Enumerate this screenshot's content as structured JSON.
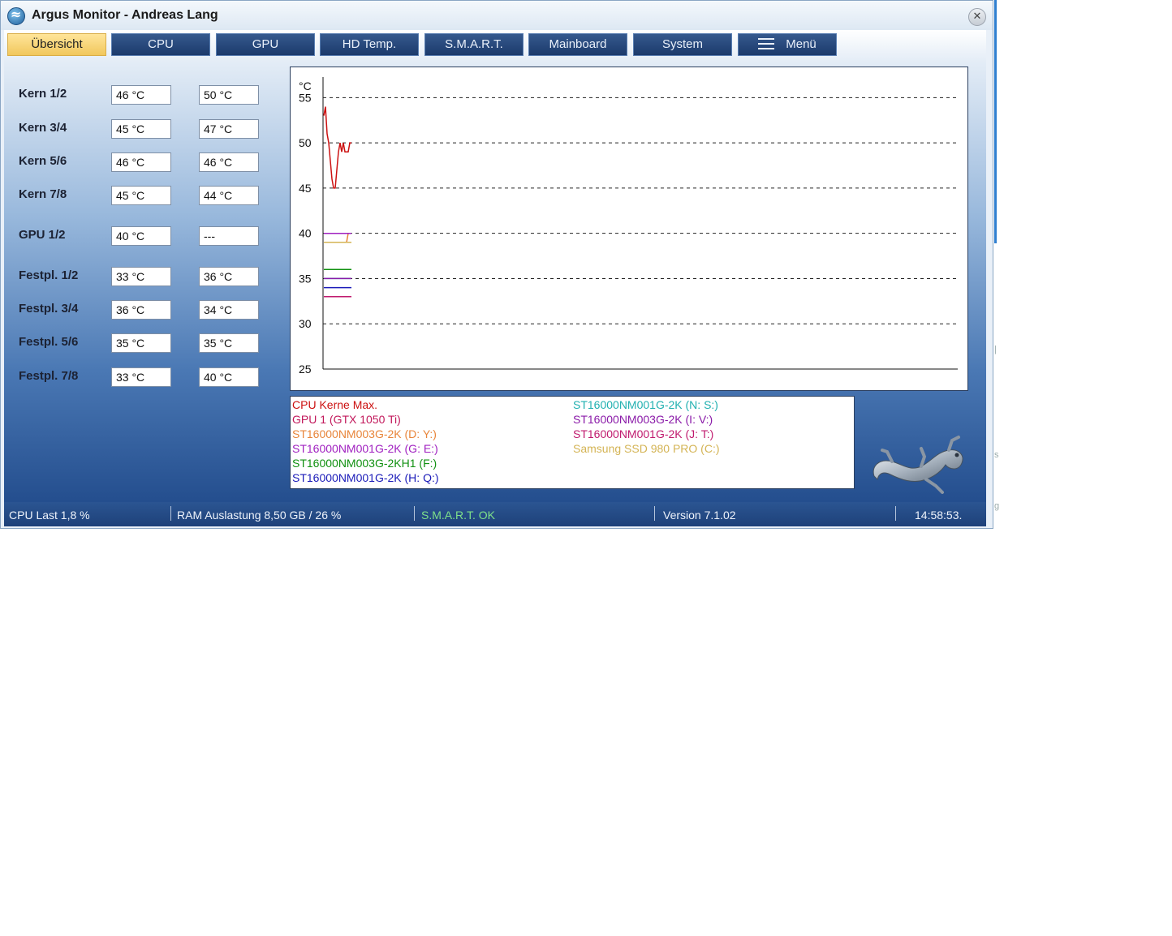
{
  "window": {
    "title": "Argus Monitor - Andreas Lang"
  },
  "tabs": [
    {
      "label": "Übersicht",
      "active": true
    },
    {
      "label": "CPU"
    },
    {
      "label": "GPU"
    },
    {
      "label": "HD Temp."
    },
    {
      "label": "S.M.A.R.T."
    },
    {
      "label": "Mainboard"
    },
    {
      "label": "System"
    },
    {
      "label": "Menü",
      "icon": "hamburger-menu-icon"
    }
  ],
  "sensors": [
    {
      "label": "Kern 1/2",
      "v1": "46 °C",
      "v2": "50 °C"
    },
    {
      "label": "Kern 3/4",
      "v1": "45 °C",
      "v2": "47 °C"
    },
    {
      "label": "Kern 5/6",
      "v1": "46 °C",
      "v2": "46 °C"
    },
    {
      "label": "Kern 7/8",
      "v1": "45 °C",
      "v2": "44 °C"
    },
    {
      "label": "GPU 1/2",
      "v1": "40 °C",
      "v2": "---"
    },
    {
      "label": "Festpl. 1/2",
      "v1": "33 °C",
      "v2": "36 °C"
    },
    {
      "label": "Festpl. 3/4",
      "v1": "36 °C",
      "v2": "34 °C"
    },
    {
      "label": "Festpl. 5/6",
      "v1": "35 °C",
      "v2": "35 °C"
    },
    {
      "label": "Festpl. 7/8",
      "v1": "33 °C",
      "v2": "40 °C"
    }
  ],
  "chart_data": {
    "type": "line",
    "unit_label": "°C",
    "ylim": [
      25,
      57
    ],
    "yticks": [
      25,
      30,
      35,
      40,
      45,
      50,
      55
    ],
    "grid": "dashed horizontal",
    "series": [
      {
        "name": "CPU Kerne Max.",
        "color": "#cc1111",
        "values": [
          53,
          54,
          51,
          50,
          48,
          46,
          45,
          45,
          47,
          49,
          50,
          49,
          50,
          49,
          49,
          49,
          50,
          50
        ]
      },
      {
        "name": "GPU 1 (GTX 1050 Ti)",
        "color": "#c2185b",
        "values": [
          40,
          40,
          40,
          40,
          40,
          40,
          40,
          40,
          40,
          40,
          40,
          40,
          40,
          40,
          40,
          40,
          40,
          40
        ]
      },
      {
        "name": "ST16000NM003G-2K (D: Y:)",
        "color": "#e8853a",
        "values": [
          39,
          39,
          39,
          39,
          39,
          39,
          39,
          39,
          39,
          39,
          39,
          39,
          39,
          39,
          39,
          40,
          40,
          40
        ]
      },
      {
        "name": "ST16000NM001G-2K (G: E:)",
        "color": "#a020c0",
        "values": [
          40,
          40,
          40,
          40,
          40,
          40,
          40,
          40,
          40,
          40,
          40,
          40,
          40,
          40,
          40,
          40,
          40,
          40
        ]
      },
      {
        "name": "ST16000NM003G-2KH1 (F:)",
        "color": "#109010",
        "values": [
          36,
          36,
          36,
          36,
          36,
          36,
          36,
          36,
          36,
          36,
          36,
          36,
          36,
          36,
          36,
          36,
          36,
          36
        ]
      },
      {
        "name": "ST16000NM001G-2K (H: Q:)",
        "color": "#1a1ab8",
        "values": [
          34,
          34,
          34,
          34,
          34,
          34,
          34,
          34,
          34,
          34,
          34,
          34,
          34,
          34,
          34,
          34,
          34,
          34
        ]
      },
      {
        "name": "ST16000NM001G-2K (N: S:)",
        "color": "#20b0b0",
        "values": [
          35,
          35,
          35,
          35,
          35,
          35,
          35,
          35,
          35,
          35,
          35,
          35,
          35,
          35,
          35,
          35,
          35,
          35
        ]
      },
      {
        "name": "ST16000NM003G-2K (I: V:)",
        "color": "#8a1aa8",
        "values": [
          35,
          35,
          35,
          35,
          35,
          35,
          35,
          35,
          35,
          35,
          35,
          35,
          35,
          35,
          35,
          35,
          35,
          35
        ]
      },
      {
        "name": "ST16000NM001G-2K (J: T:)",
        "color": "#c01a6e",
        "values": [
          33,
          33,
          33,
          33,
          33,
          33,
          33,
          33,
          33,
          33,
          33,
          33,
          33,
          33,
          33,
          33,
          33,
          33
        ]
      },
      {
        "name": "Samsung SSD 980 PRO  (C:)",
        "color": "#d4b455",
        "values": [
          39,
          39,
          39,
          39,
          39,
          39,
          39,
          39,
          39,
          39,
          39,
          39,
          39,
          39,
          39,
          39,
          39,
          39
        ]
      }
    ]
  },
  "status": {
    "cpu": "CPU Last 1,8 %",
    "ram": "RAM Auslastung 8,50 GB / 26 %",
    "smart": "S.M.A.R.T. OK",
    "version": "Version 7.1.02",
    "time": "14:58:53."
  },
  "colors": {
    "smart_ok": "#7ee08a",
    "active_tab": "#f1c75c",
    "tab": "#1c3a6b"
  }
}
